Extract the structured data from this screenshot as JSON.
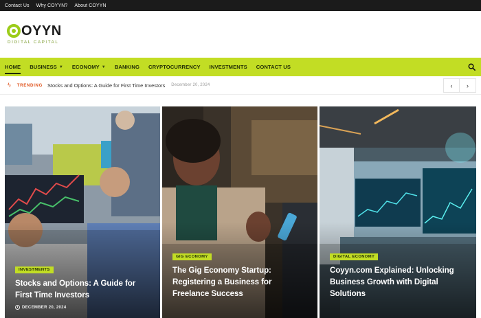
{
  "topbar": {
    "links": [
      "Contact Us",
      "Why COYYN?",
      "About COYYN"
    ]
  },
  "logo": {
    "name": "OYYN",
    "tagline": "DIGITAL CAPITAL"
  },
  "nav": {
    "items": [
      {
        "label": "HOME"
      },
      {
        "label": "BUSINESS"
      },
      {
        "label": "ECONOMY"
      },
      {
        "label": "BANKING"
      },
      {
        "label": "CRYPTOCURRENCY"
      },
      {
        "label": "INVESTMENTS"
      },
      {
        "label": "CONTACT US"
      }
    ],
    "search_icon": "search-icon"
  },
  "trending": {
    "label": "TRENDING",
    "title": "Stocks and Options: A Guide for First Time Investors",
    "date": "December 20, 2024"
  },
  "cards": [
    {
      "tag": "INVESTMENTS",
      "title": "Stocks and Options: A Guide for First Time Investors",
      "date": "DECEMBER 20, 2024"
    },
    {
      "tag": "GIG ECONOMY",
      "title": "The Gig Economy Startup: Registering a Business for Freelance Success"
    },
    {
      "tag": "DIGITAL ECONOMY",
      "title": "Coyyn.com Explained: Unlocking Business Growth with Digital Solutions"
    }
  ],
  "colors": {
    "accent": "#c2dd24",
    "trending": "#e0551f",
    "topbar": "#1b1b1b"
  }
}
